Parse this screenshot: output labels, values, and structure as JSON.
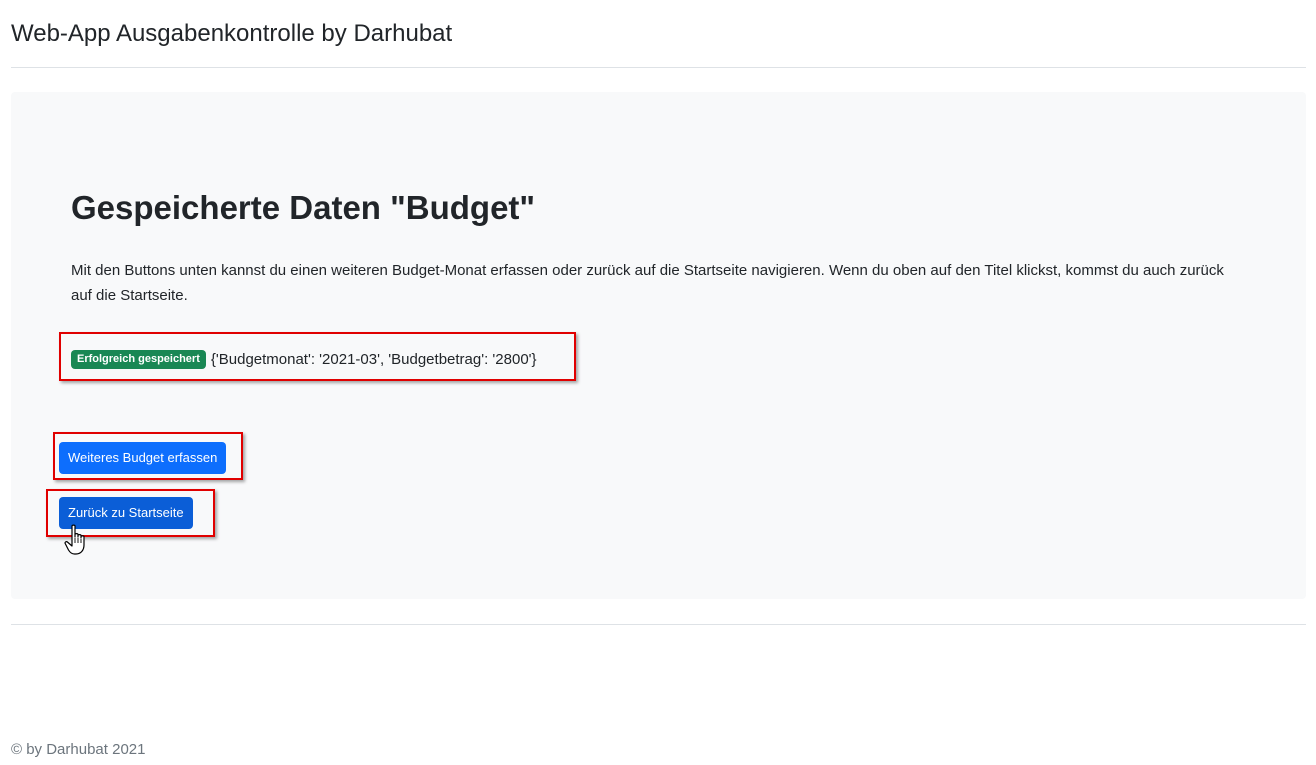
{
  "header": {
    "title": "Web-App Ausgabenkontrolle by Darhubat"
  },
  "main": {
    "heading": "Gespeicherte Daten \"Budget\"",
    "lead": "Mit den Buttons unten kannst du einen weiteren Budget-Monat erfassen oder zurück auf die Startseite navigieren. Wenn du oben auf den Titel klickst, kommst du auch zurück auf die Startseite.",
    "status_badge": "Erfolgreich gespeichert",
    "saved_value": "{'Budgetmonat': '2021-03', 'Budgetbetrag': '2800'}",
    "buttons": {
      "add_budget": "Weiteres Budget erfassen",
      "back_home": "Zurück zu Startseite"
    }
  },
  "footer": {
    "text": "© by Darhubat 2021"
  },
  "colors": {
    "primary": "#0d6efd",
    "primary_hover": "#0b5ed7",
    "success": "#198754",
    "panel_bg": "#f8f9fa",
    "highlight": "#e00000"
  },
  "icons": {
    "cursor": "hand-pointer-icon"
  }
}
